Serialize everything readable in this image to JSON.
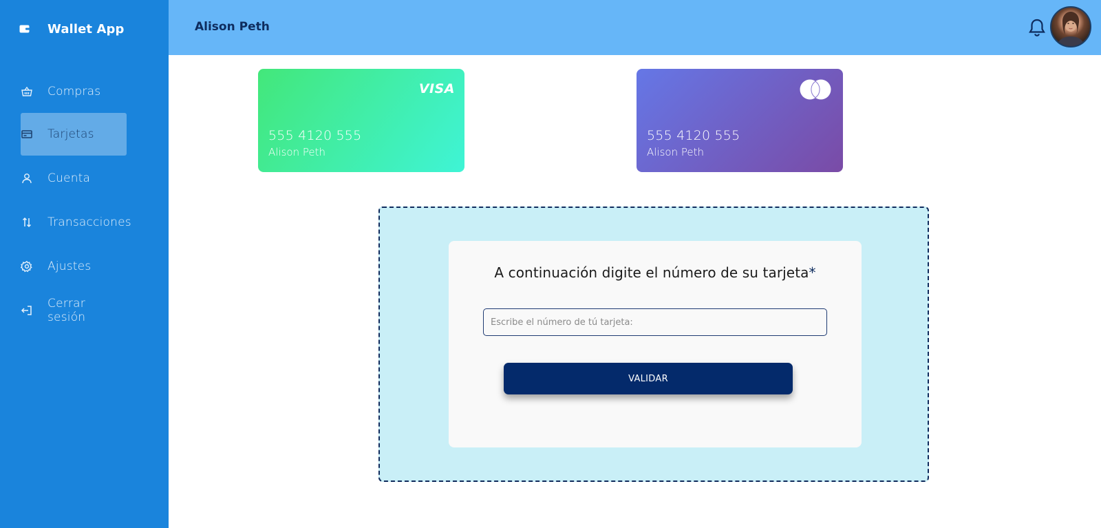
{
  "app": {
    "title": "Wallet App"
  },
  "sidebar": {
    "items": [
      {
        "label": "Compras",
        "icon": "basket-icon"
      },
      {
        "label": "Tarjetas",
        "icon": "card-icon",
        "active": true
      },
      {
        "label": "Cuenta",
        "icon": "user-icon"
      },
      {
        "label": "Transacciones",
        "icon": "transfer-arrows-icon"
      },
      {
        "label": "Ajustes",
        "icon": "gear-icon"
      },
      {
        "label": "Cerrar sesión",
        "icon": "logout-icon"
      }
    ]
  },
  "header": {
    "user_name": "Alison Peth",
    "notification_icon": "bell-icon",
    "avatar_icon": "avatar"
  },
  "cards": [
    {
      "brand": "VISA",
      "number": "555 4120 555",
      "holder": "Alison Peth"
    },
    {
      "brand": "mastercard-icon",
      "number": "555 4120 555",
      "holder": "Alison Peth"
    }
  ],
  "form": {
    "prompt": "A continuación digite el número de su tarjeta",
    "required_mark": "*",
    "input_placeholder": "Escribe el número de tú tarjeta:",
    "input_value": "",
    "submit_label": "VALIDAR"
  },
  "colors": {
    "sidebar": "#1a84dc",
    "header": "#66b6f8",
    "primary_button": "#042a6b",
    "drop_zone": "#c9eff7"
  }
}
